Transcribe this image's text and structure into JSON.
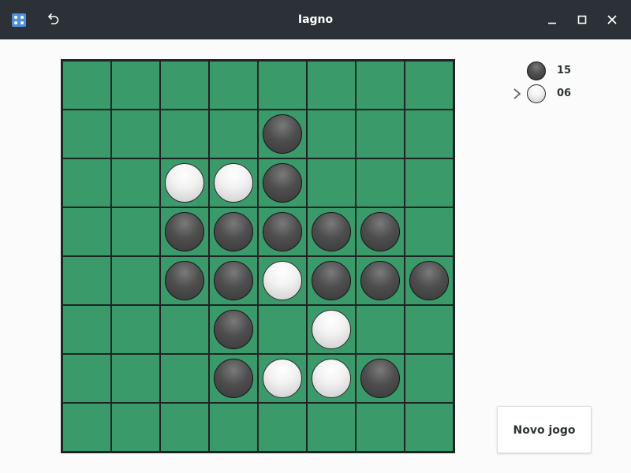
{
  "window": {
    "title": "Iagno",
    "app_icon": "dice-icon",
    "controls": [
      "undo-icon",
      "minimize-icon",
      "maximize-icon",
      "close-icon"
    ],
    "titlebar_color": "#2b3136"
  },
  "board": {
    "size": 8,
    "cell_color": "#3a9a6a",
    "line_color": "#1d2423",
    "cells": [
      [
        "",
        "",
        "",
        "",
        "",
        "",
        "",
        ""
      ],
      [
        "",
        "",
        "",
        "",
        "B",
        "",
        "",
        ""
      ],
      [
        "",
        "",
        "W",
        "W",
        "B",
        "",
        "",
        ""
      ],
      [
        "",
        "",
        "B",
        "B",
        "B",
        "B",
        "B",
        ""
      ],
      [
        "",
        "",
        "B",
        "B",
        "W",
        "B",
        "B",
        "B"
      ],
      [
        "",
        "",
        "",
        "B",
        "",
        "W",
        "",
        ""
      ],
      [
        "",
        "",
        "",
        "B",
        "W",
        "W",
        "B",
        ""
      ],
      [
        "",
        "",
        "",
        "",
        "",
        "",
        "",
        ""
      ]
    ]
  },
  "scores": {
    "dark": {
      "value": "15",
      "disc": "dark"
    },
    "light": {
      "value": "06",
      "disc": "light",
      "current_turn": true
    }
  },
  "actions": {
    "new_game_label": "Novo jogo"
  }
}
